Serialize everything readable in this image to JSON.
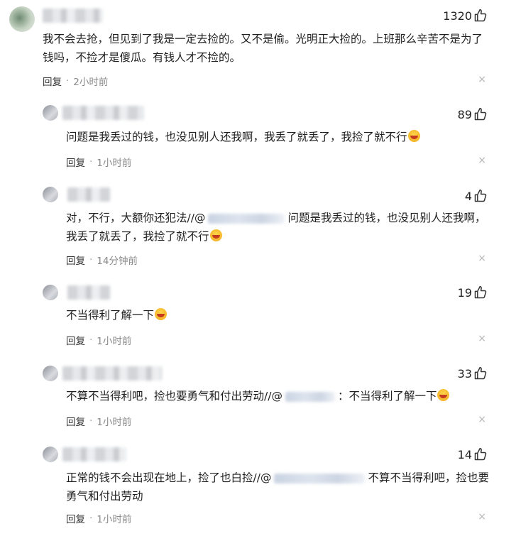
{
  "comments": [
    {
      "likes": "1320",
      "text": "我不会去抢，但见到了我是一定去捡的。又不是偷。光明正大捡的。上班那么辛苦不是为了钱吗，不捡才是傻瓜。有钱人才不捡的。",
      "reply": "回复",
      "time": "2小时前"
    },
    {
      "likes": "89",
      "text": "问题是我丢过的钱，也没见别人还我啊，我丢了就丢了，我捡了就不行",
      "reply": "回复",
      "time": "1小时前"
    },
    {
      "likes": "4",
      "text_before": "对，不行，大额你还犯法//@",
      "text_after": "问题是我丢过的钱，也没见别人还我啊，我丢了就丢了，我捡了就不行",
      "reply": "回复",
      "time": "14分钟前"
    },
    {
      "likes": "19",
      "text": "不当得利了解一下",
      "reply": "回复",
      "time": "1小时前"
    },
    {
      "likes": "33",
      "text_before": "不算不当得利吧，捡也要勇气和付出劳动//@",
      "text_after": "：不当得利了解一下",
      "reply": "回复",
      "time": "1小时前"
    },
    {
      "likes": "14",
      "text_before": "正常的钱不会出现在地上，捡了也白捡//@",
      "text_after": "不算不当得利吧，捡也要勇气和付出劳动",
      "reply": "回复",
      "time": "1小时前"
    }
  ],
  "icons": {
    "like": "thumbs-up-icon",
    "close": "close-icon",
    "emoji": "laughing-crying-emoji"
  },
  "close_glyph": "×",
  "dot_glyph": "·"
}
